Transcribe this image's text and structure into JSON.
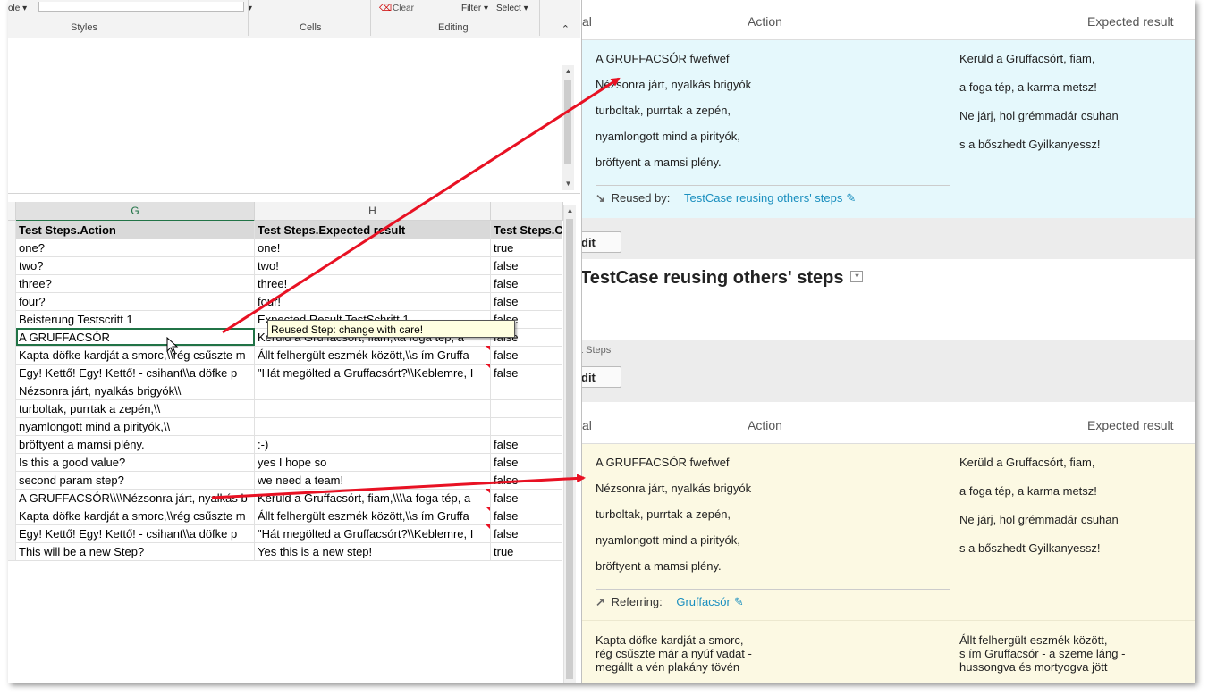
{
  "ribbon": {
    "style_label": "ole",
    "groups": [
      "Styles",
      "Cells",
      "Editing"
    ],
    "clear_label": "Clear",
    "filter_label": "Filter",
    "select_label": "Select"
  },
  "columns": {
    "g": "G",
    "h": "H"
  },
  "sheet": {
    "header": [
      "Test Steps.Action",
      "Test Steps.Expected result",
      "Test Steps.C"
    ],
    "rows": [
      [
        "one?",
        "one!",
        "true"
      ],
      [
        "two?",
        "two!",
        "false"
      ],
      [
        "three?",
        "three!",
        "false"
      ],
      [
        "four?",
        "four!",
        "false"
      ],
      [
        "Beisterung Testscritt 1",
        "Expected Result TestSchritt 1",
        "false"
      ],
      [
        "A GRUFFACSÓR",
        "Kerüld a Gruffacsórt, fiam,\\\\a foga tép, a",
        "false"
      ],
      [
        "Kapta döfke kardját a smorc,\\\\rég csűszte m",
        "Állt felhergült eszmék között,\\\\s ím Gruffa",
        "false"
      ],
      [
        "Egy! Kettő! Egy! Kettő! - csihant\\\\a döfke p",
        "\"Hát megölted a Gruffacsórt?\\\\Keblemre, I",
        "false"
      ],
      [
        "Nézsonra járt, nyalkás brigyók\\\\",
        "",
        ""
      ],
      [
        "turboltak, purrtak a zepén,\\\\",
        "",
        ""
      ],
      [
        "nyamlongott mind a pirityók,\\\\",
        "",
        ""
      ],
      [
        "bröftyent a mamsi plény.",
        ":-)",
        "false"
      ],
      [
        "Is this a good value?",
        "yes I hope so",
        "false"
      ],
      [
        "second param step?",
        "we need a team!",
        "false"
      ],
      [
        "A GRUFFACSÓR\\\\\\\\Nézsonra járt, nyalkás b",
        "Kerüld a Gruffacsórt, fiam,\\\\\\\\a foga tép, a",
        "false"
      ],
      [
        "Kapta döfke kardját a smorc,\\\\rég csűszte m",
        "Állt felhergült eszmék között,\\\\s ím Gruffa",
        "false"
      ],
      [
        "Egy! Kettő! Egy! Kettő! - csihant\\\\a döfke p",
        "\"Hát megölted a Gruffacsórt?\\\\Keblemre, I",
        "false"
      ],
      [
        "This will be a new Step?",
        "Yes this is a new step!",
        "true"
      ]
    ],
    "tooltip": "Reused Step: change with care!"
  },
  "web": {
    "col_left": "al",
    "col_action": "Action",
    "col_expected": "Expected result",
    "step1": {
      "action_lines": [
        "A GRUFFACSÓR fwefwef",
        "Nézsonra járt, nyalkás brigyók",
        "turboltak, purrtak a zepén,",
        "nyamlongott mind a pirityók,",
        "bröftyent a mamsi plény."
      ],
      "expected_lines": [
        "Kerüld a Gruffacsórt, fiam,",
        "a foga tép, a karma metsz!",
        "Ne járj, hol grémmadár csuhan",
        "s a bőszhedt Gyilkanyessz!"
      ],
      "reused_label": "Reused by:",
      "reused_link": "TestCase reusing others' steps"
    },
    "edit_label": "dit",
    "testcase_title": "TestCase reusing others' steps",
    "test_steps_label": "t Steps",
    "step2": {
      "action_lines": [
        "A GRUFFACSÓR fwefwef",
        "Nézsonra járt, nyalkás brigyók",
        "turboltak, purrtak a zepén,",
        "nyamlongott mind a pirityók,",
        "bröftyent a mamsi plény."
      ],
      "expected_lines": [
        "Kerüld a Gruffacsórt, fiam,",
        "a foga tép, a karma metsz!",
        "Ne járj, hol grémmadár csuhan",
        "s a bőszhedt Gyilkanyessz!"
      ],
      "referring_label": "Referring:",
      "referring_link": "Gruffacsór"
    },
    "step3": {
      "action_lines": [
        "Kapta döfke kardját a smorc,",
        "rég csűszte már a nyúf vadat -",
        "megállt a vén plakány tövén"
      ],
      "expected_lines": [
        "Állt felhergült eszmék között,",
        "s ím Gruffacsór - a szeme láng -",
        "hussongva és mortyogva jött"
      ]
    }
  },
  "colors": {
    "excel_green": "#217346",
    "link_blue": "#1a8fbf",
    "arrow_red": "#e81123",
    "reused_bg": "#e5f8fc",
    "referring_bg": "#fcf9e3"
  }
}
